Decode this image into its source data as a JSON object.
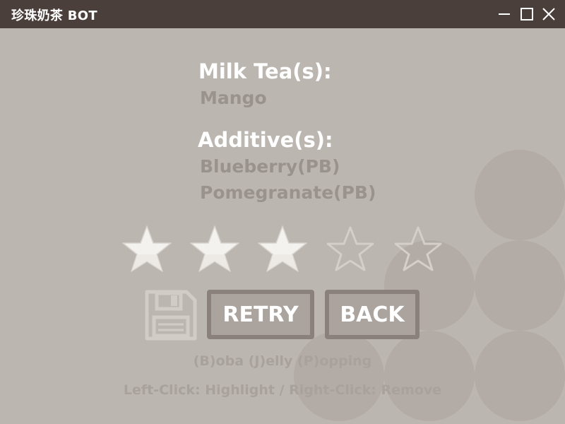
{
  "window": {
    "title": "珍珠奶茶 BOT",
    "icons": [
      "minimize-icon",
      "maximize-icon",
      "close-icon"
    ]
  },
  "order": {
    "milk_tea_heading": "Milk Tea(s):",
    "milk_teas": [
      "Mango"
    ],
    "additive_heading": "Additive(s):",
    "additives": [
      "Blueberry(PB)",
      "Pomegranate(PB)"
    ]
  },
  "rating": {
    "value": 3,
    "max": 5
  },
  "actions": {
    "save_icon": "floppy-disk-icon",
    "retry_label": "RETRY",
    "back_label": "BACK"
  },
  "hints": {
    "legend": "(B)oba (J)elly (P)opping",
    "controls": "Left-Click: Highlight / Right-Click: Remove"
  },
  "colors": {
    "background": "#bcb6b0",
    "titlebar": "#4a3f3a",
    "star_filled": "#f4f2ee",
    "star_empty_outline": "#d4cfca",
    "button_border": "#8a817c"
  }
}
